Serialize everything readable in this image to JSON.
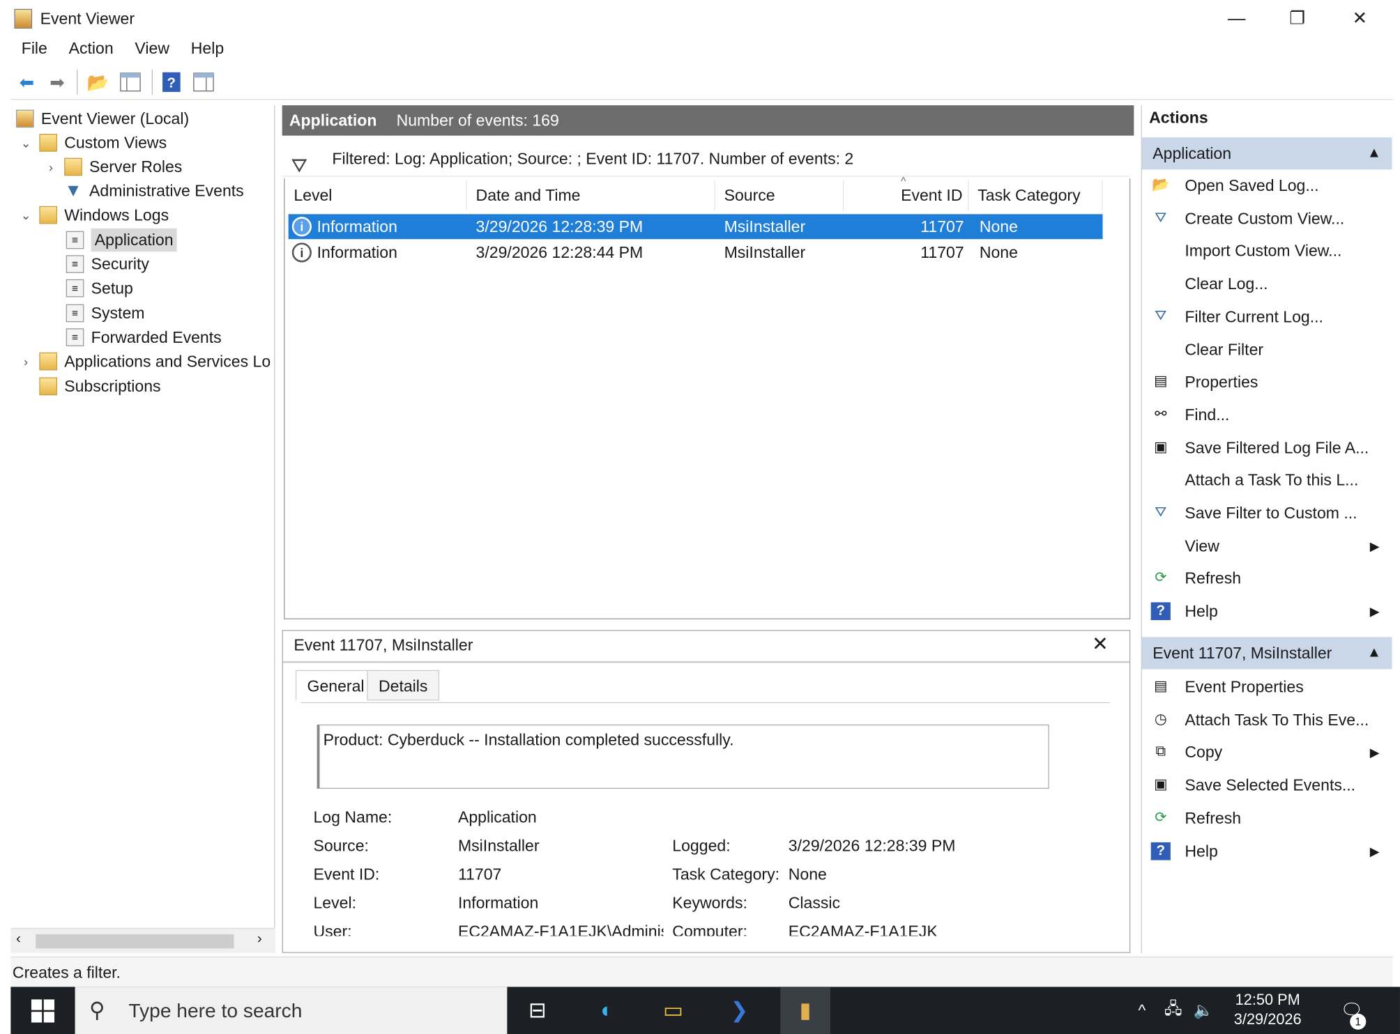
{
  "window": {
    "title": "Event Viewer",
    "controls": {
      "minimize": "—",
      "restore": "❐",
      "close": "✕"
    }
  },
  "menu": [
    "File",
    "Action",
    "View",
    "Help"
  ],
  "tree": {
    "items": [
      {
        "label": "Event Viewer (Local)",
        "icon": "event-viewer-icon",
        "expander": ""
      },
      {
        "label": "Custom Views",
        "icon": "folder-icon",
        "expander": "v"
      },
      {
        "label": "Server Roles",
        "icon": "folder-icon",
        "expander": ">"
      },
      {
        "label": "Administrative Events",
        "icon": "filter-icon",
        "expander": ""
      },
      {
        "label": "Windows Logs",
        "icon": "folder-icon",
        "expander": "v"
      },
      {
        "label": "Application",
        "icon": "log-icon",
        "expander": ""
      },
      {
        "label": "Security",
        "icon": "log-icon",
        "expander": ""
      },
      {
        "label": "Setup",
        "icon": "log-icon",
        "expander": ""
      },
      {
        "label": "System",
        "icon": "log-icon",
        "expander": ""
      },
      {
        "label": "Forwarded Events",
        "icon": "log-icon",
        "expander": ""
      },
      {
        "label": "Applications and Services Lo",
        "icon": "folder-icon",
        "expander": ">"
      },
      {
        "label": "Subscriptions",
        "icon": "subscriptions-icon",
        "expander": ""
      }
    ]
  },
  "center": {
    "log_name": "Application",
    "event_count": "Number of events: 169",
    "filter_text": "Filtered: Log: Application; Source: ; Event ID: 11707. Number of events: 2",
    "columns": [
      "Level",
      "Date and Time",
      "Source",
      "Event ID",
      "Task Category"
    ],
    "rows": [
      {
        "level": "Information",
        "datetime": "3/29/2026 12:28:39 PM",
        "source": "MsiInstaller",
        "event_id": "11707",
        "category": "None",
        "selected": true
      },
      {
        "level": "Information",
        "datetime": "3/29/2026 12:28:44 PM",
        "source": "MsiInstaller",
        "event_id": "11707",
        "category": "None",
        "selected": false
      }
    ]
  },
  "detail": {
    "title": "Event 11707, MsiInstaller",
    "close": "✕",
    "tabs": [
      "General",
      "Details"
    ],
    "description": "Product: Cyberduck -- Installation completed successfully.",
    "fields": {
      "log_name_label": "Log Name:",
      "log_name": "Application",
      "source_label": "Source:",
      "source": "MsiInstaller",
      "logged_label": "Logged:",
      "logged": "3/29/2026 12:28:39 PM",
      "event_id_label": "Event ID:",
      "event_id": "11707",
      "task_category_label": "Task Category:",
      "task_category": "None",
      "level_label": "Level:",
      "level": "Information",
      "keywords_label": "Keywords:",
      "keywords": "Classic",
      "user_label": "User:",
      "user": "EC2AMAZ-F1A1EJK\\Adminis",
      "computer_label": "Computer:",
      "computer": "EC2AMAZ-F1A1EJK"
    }
  },
  "actions": {
    "title": "Actions",
    "section1": "Application",
    "items1": [
      {
        "label": "Open Saved Log...",
        "icon": "open-folder-icon",
        "submenu": false
      },
      {
        "label": "Create Custom View...",
        "icon": "filter-icon",
        "submenu": false
      },
      {
        "label": "Import Custom View...",
        "icon": "",
        "submenu": false
      },
      {
        "label": "Clear Log...",
        "icon": "",
        "submenu": false
      },
      {
        "label": "Filter Current Log...",
        "icon": "filter-icon",
        "submenu": false
      },
      {
        "label": "Clear Filter",
        "icon": "",
        "submenu": false
      },
      {
        "label": "Properties",
        "icon": "properties-icon",
        "submenu": false
      },
      {
        "label": "Find...",
        "icon": "binoculars-icon",
        "submenu": false
      },
      {
        "label": "Save Filtered Log File A...",
        "icon": "save-icon",
        "submenu": false
      },
      {
        "label": "Attach a Task To this L...",
        "icon": "",
        "submenu": false
      },
      {
        "label": "Save Filter to Custom ...",
        "icon": "save-filter-icon",
        "submenu": false
      },
      {
        "label": "View",
        "icon": "",
        "submenu": true
      },
      {
        "label": "Refresh",
        "icon": "refresh-icon",
        "submenu": false
      },
      {
        "label": "Help",
        "icon": "help-icon",
        "submenu": true
      }
    ],
    "section2": "Event 11707, MsiInstaller",
    "items2": [
      {
        "label": "Event Properties",
        "icon": "properties-icon",
        "submenu": false
      },
      {
        "label": "Attach Task To This Eve...",
        "icon": "task-icon",
        "submenu": false
      },
      {
        "label": "Copy",
        "icon": "copy-icon",
        "submenu": true
      },
      {
        "label": "Save Selected Events...",
        "icon": "save-icon",
        "submenu": false
      },
      {
        "label": "Refresh",
        "icon": "refresh-icon",
        "submenu": false
      },
      {
        "label": "Help",
        "icon": "help-icon",
        "submenu": true
      }
    ]
  },
  "status": "Creates a filter.",
  "taskbar": {
    "search_placeholder": "Type here to search",
    "time": "12:50 PM",
    "date": "3/29/2026",
    "notification_count": "1"
  }
}
